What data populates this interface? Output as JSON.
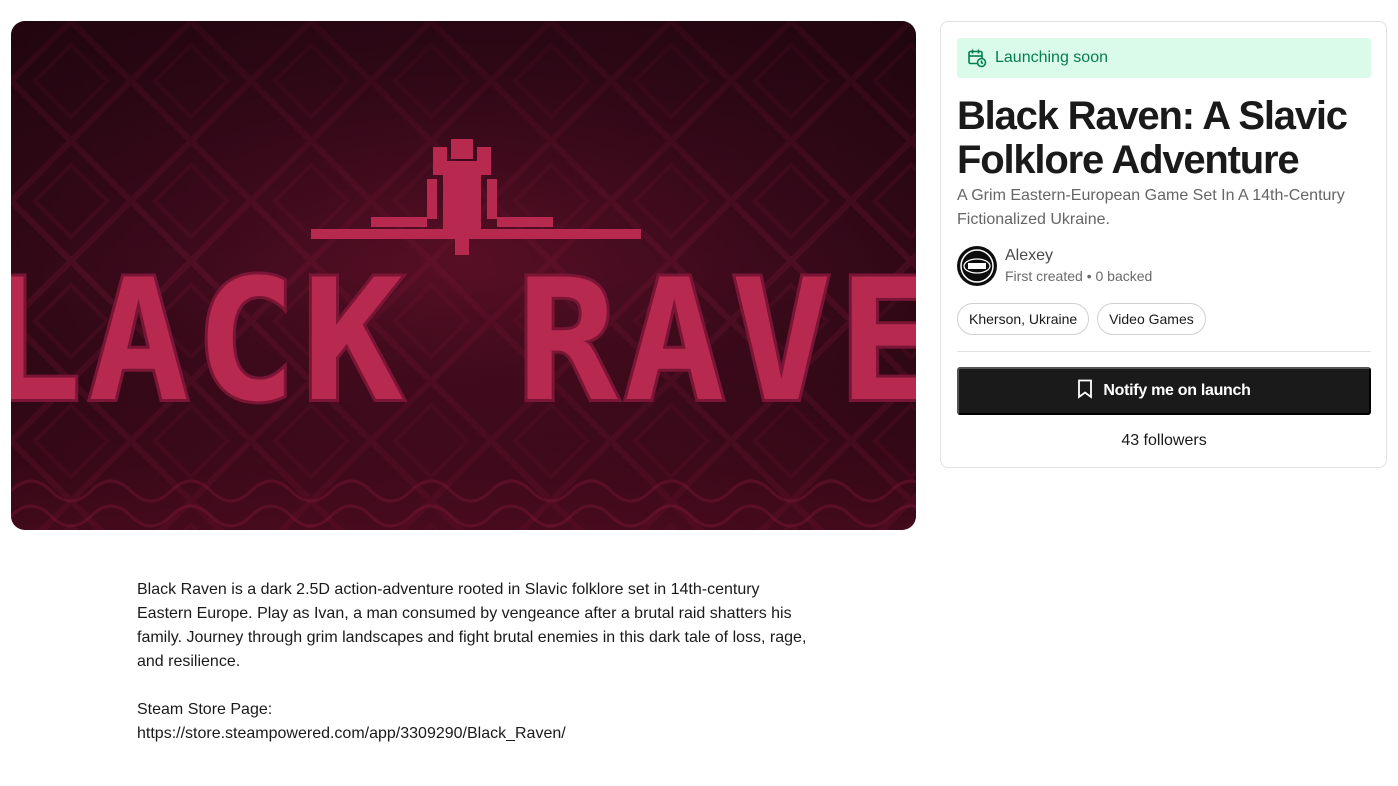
{
  "hero": {
    "image_alt": "Black Raven",
    "logo_text": "BLACK RAVEN",
    "colors": {
      "bg_dark": "#22060f",
      "bg_mid": "#5a0f26",
      "letters": "#b8294f",
      "letters_shadow": "#7a1535"
    }
  },
  "project": {
    "status_label": "Launching soon",
    "status_icon": "calendar-clock-icon",
    "title": "Black Raven: A Slavic Folklore Adventure",
    "subtitle": "A Grim Eastern-European Game Set In A 14th-Century Fictionalized Ukraine.",
    "creator": {
      "name": "Alexey",
      "meta": "First created • 0 backed"
    },
    "tags": [
      "Kherson, Ukraine",
      "Video Games"
    ],
    "notify_label": "Notify me on launch",
    "notify_icon": "bookmark-icon",
    "followers": "43 followers"
  },
  "description": {
    "paragraph": "Black Raven is a dark 2.5D action-adventure rooted in Slavic folklore set in 14th-century Eastern Europe. Play as Ivan, a man consumed by vengeance after a brutal raid shatters his family. Journey through grim landscapes and fight brutal enemies in this dark tale of loss, rage, and resilience.",
    "store_label": "Steam Store Page:",
    "store_url": "https://store.steampowered.com/app/3309290/Black_Raven/"
  },
  "theme": {
    "accent_green_bg": "#dafbea",
    "accent_green_text": "#037e4e",
    "button_bg": "#1a1a1a"
  }
}
